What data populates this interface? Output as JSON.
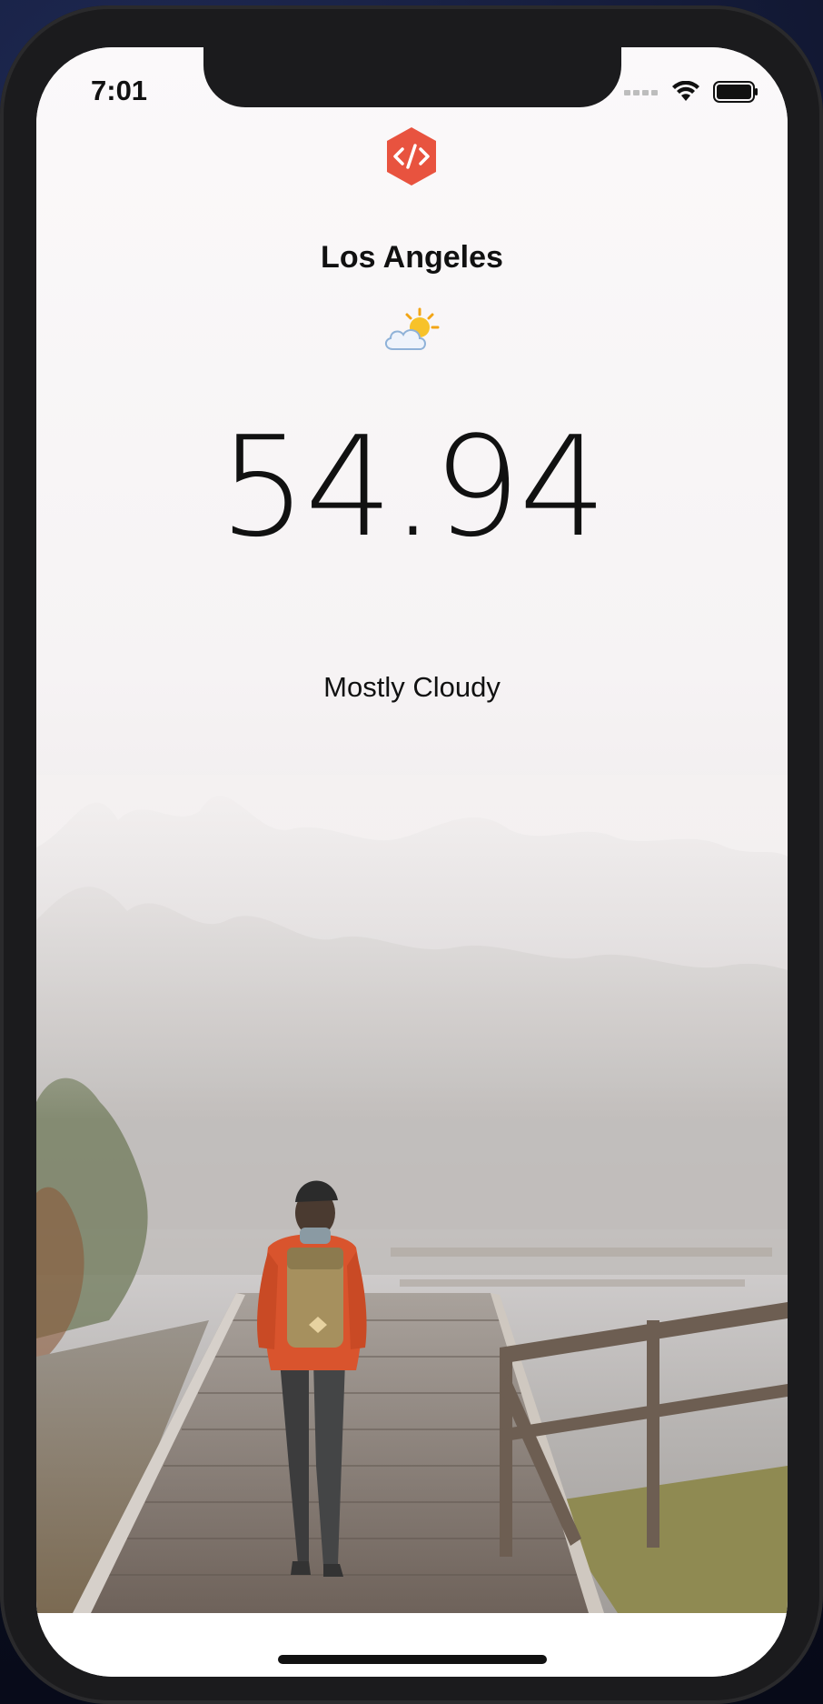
{
  "status_bar": {
    "time": "7:01",
    "icons": [
      "cellular-signal-icon",
      "wifi-icon",
      "battery-icon"
    ]
  },
  "app": {
    "logo_icon": "code-brackets-hexagon-icon",
    "logo_color": "#E8533F"
  },
  "weather": {
    "city": "Los Angeles",
    "icon": "sun-behind-cloud-icon",
    "temperature": "54.94",
    "condition": "Mostly Cloudy"
  },
  "background_image": "foggy-boardwalk-hiker-photo"
}
